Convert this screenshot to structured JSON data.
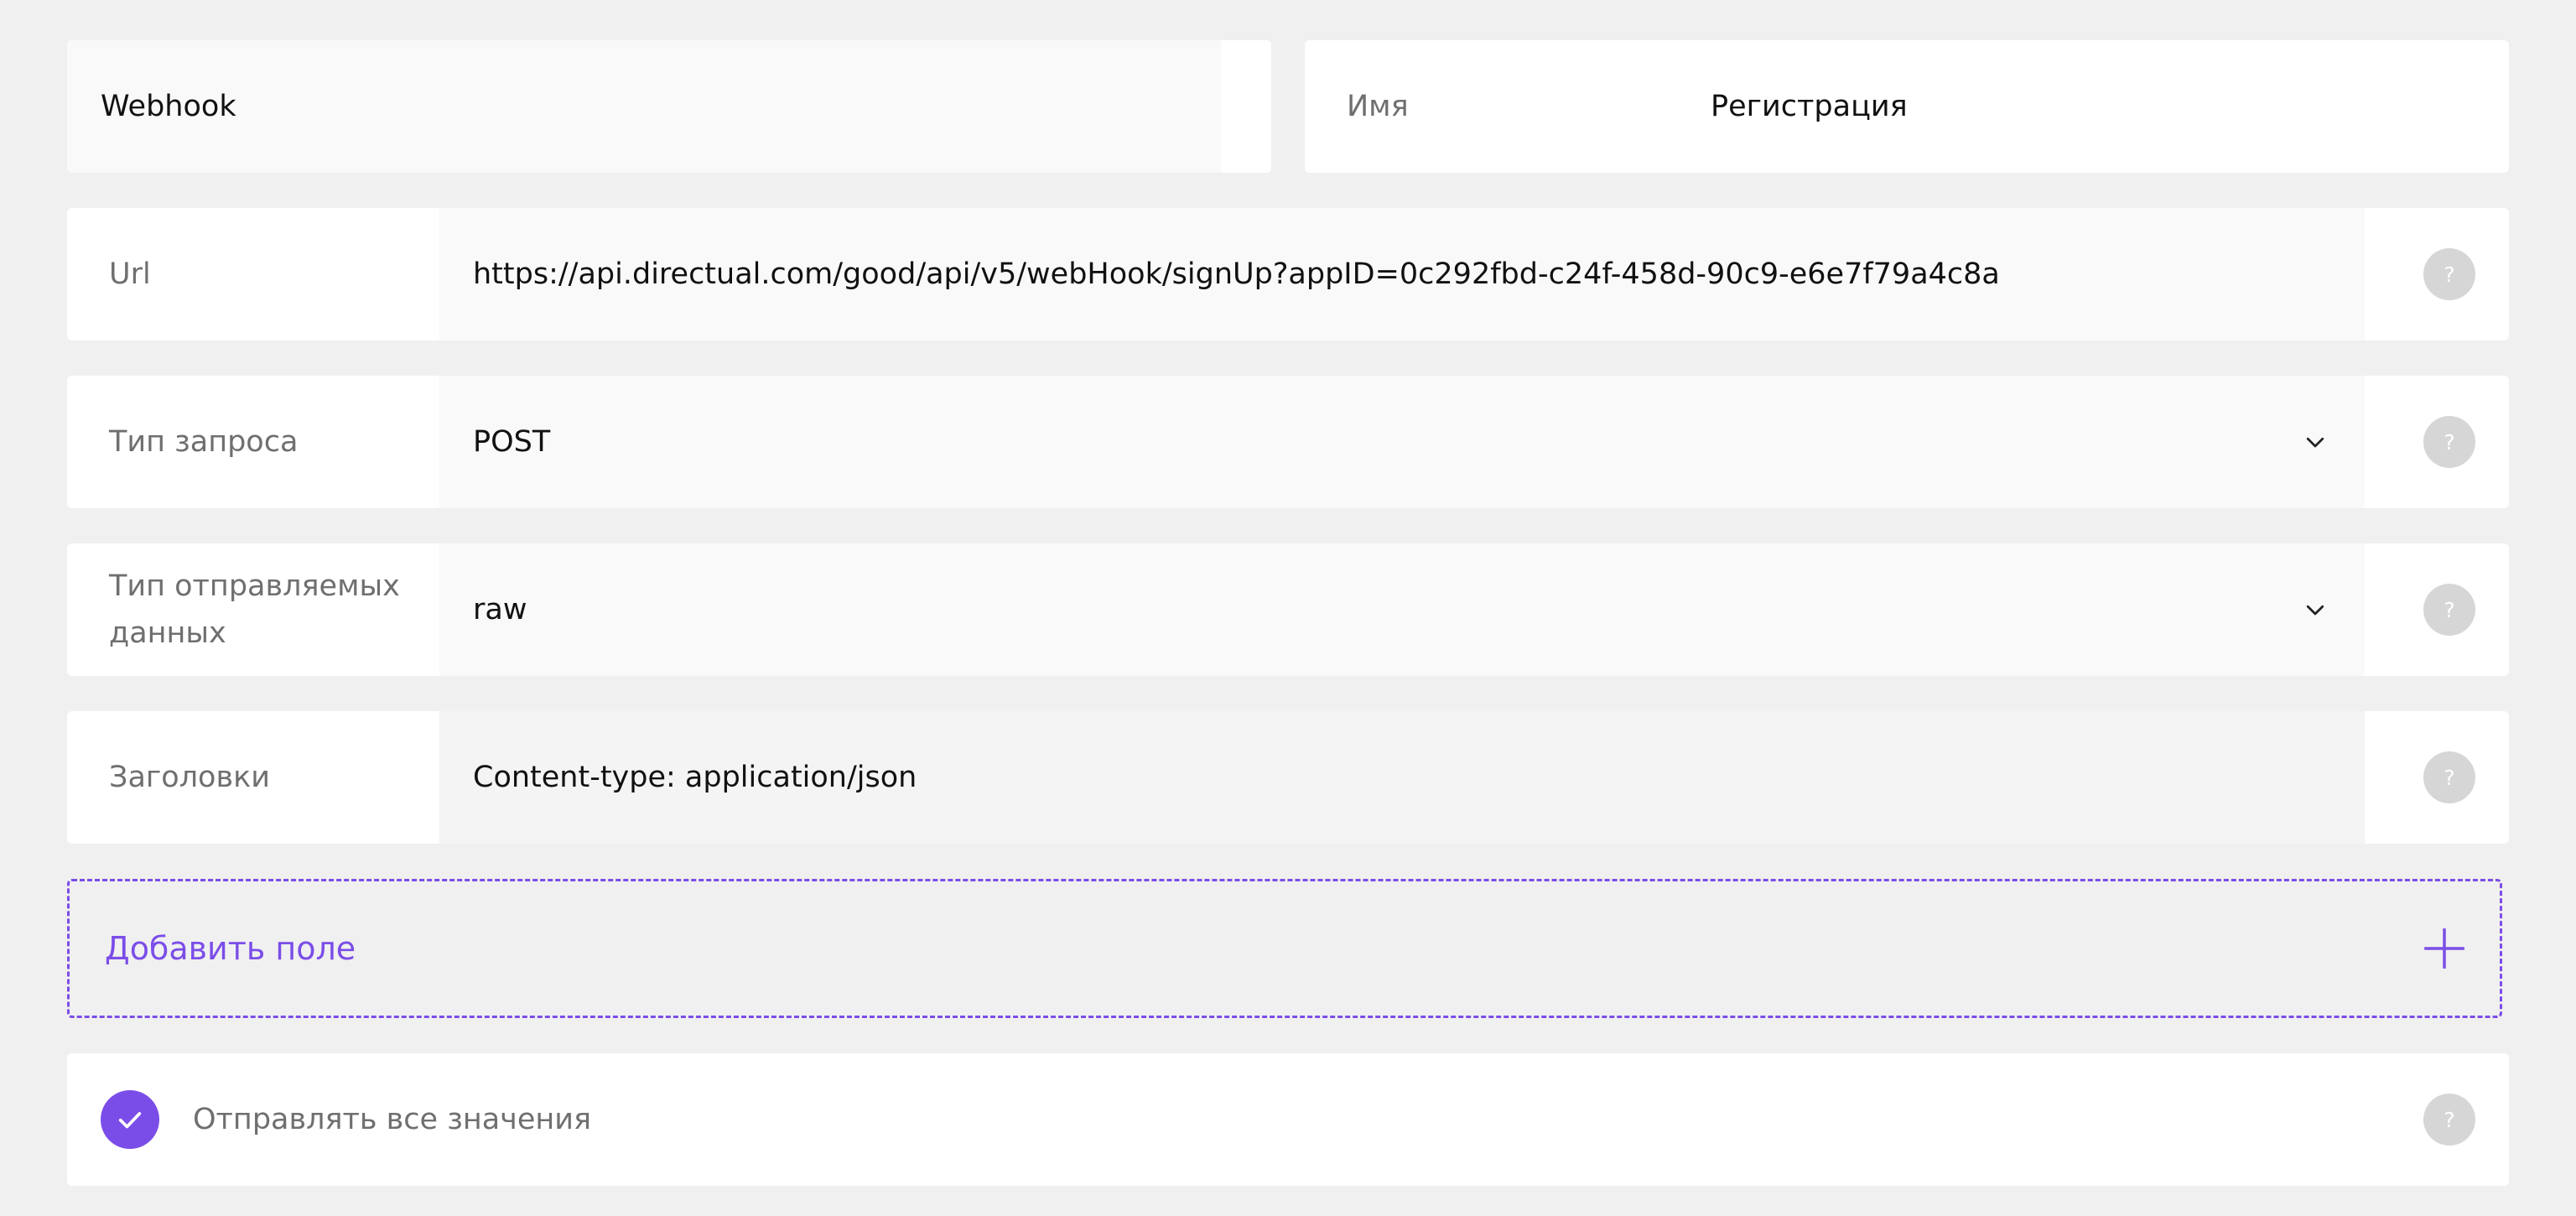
{
  "type_select": {
    "value": "Webhook",
    "icon": "chevron-down-icon"
  },
  "name_field": {
    "label": "Имя",
    "value": "Регистрация"
  },
  "url_field": {
    "label": "Url",
    "value": "https://api.directual.com/good/api/v5/webHook/signUp?appID=0c292fbd-c24f-458d-90c9-e6e7f79a4c8a",
    "help": "?"
  },
  "request_type": {
    "label": "Тип запроса",
    "value": "POST",
    "help": "?",
    "icon": "chevron-down-icon"
  },
  "data_type": {
    "label": "Тип отправляемых данных",
    "value": "raw",
    "help": "?",
    "icon": "chevron-down-icon"
  },
  "headers": {
    "label": "Заголовки",
    "value": "Content-type: application/json",
    "help": "?"
  },
  "add_field": {
    "label": "Добавить поле",
    "icon": "plus-icon"
  },
  "send_all": {
    "label": "Отправлять все значения",
    "checked": true,
    "help": "?",
    "icon": "check-icon"
  },
  "colors": {
    "accent": "#7b4de8",
    "background": "#f0f0f0",
    "help_circle": "#d6d6d6"
  }
}
